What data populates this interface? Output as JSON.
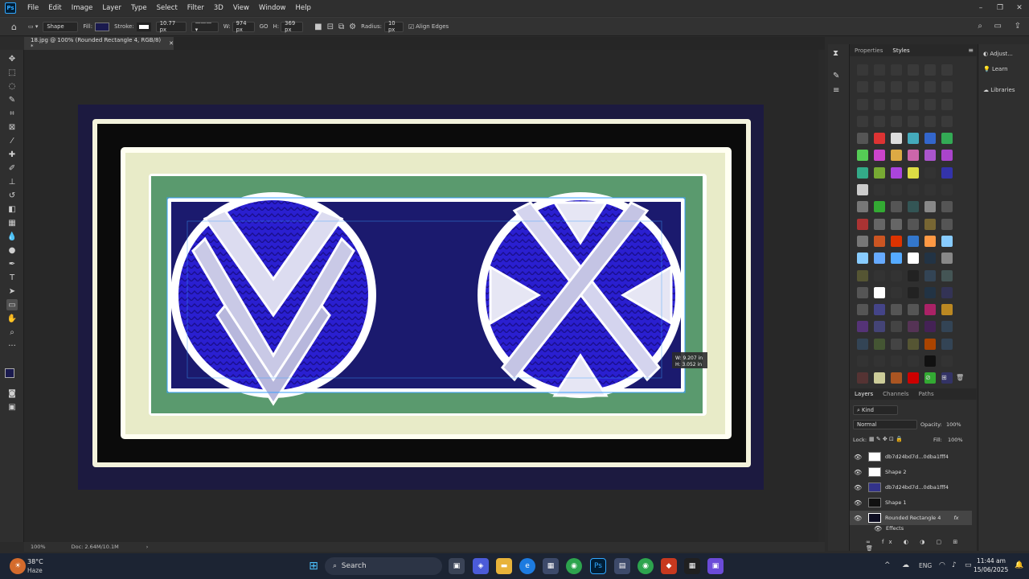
{
  "menu": [
    "File",
    "Edit",
    "Image",
    "Layer",
    "Type",
    "Select",
    "Filter",
    "3D",
    "View",
    "Window",
    "Help"
  ],
  "options": {
    "mode": "Shape",
    "fill_label": "Fill:",
    "stroke_label": "Stroke:",
    "stroke_width": "10.77 px",
    "w_label": "W:",
    "w_value": "974 px",
    "link": "GO",
    "h_label": "H:",
    "h_value": "369 px",
    "radius_label": "Radius:",
    "radius_value": "10 px",
    "align_edges": "Align Edges",
    "fill_color": "#1a1a4e",
    "stroke_color": "#ffffff"
  },
  "document": {
    "tab_title": "18.jpg @ 100% (Rounded Rectangle 4, RGB/8) *",
    "zoom": "100%",
    "doc_info": "Doc: 2.64M/10.1M",
    "transform_w": "W: 9.207 in",
    "transform_h": "H: 3.052 in"
  },
  "panels": {
    "top_tabs": [
      "Properties",
      "Styles"
    ],
    "right_items": [
      "Adjust...",
      "Learn",
      "Libraries"
    ],
    "layer_tabs": [
      "Layers",
      "Channels",
      "Paths"
    ],
    "kind": "Kind",
    "blend": "Normal",
    "opacity_label": "Opacity:",
    "opacity": "100%",
    "lock_label": "Lock:",
    "fill_label": "Fill:",
    "fill": "100%",
    "layers": [
      {
        "name": "db7d24bd7d...0dba1fff4"
      },
      {
        "name": "Shape 2"
      },
      {
        "name": "db7d24bd7d...0dba1fff4"
      },
      {
        "name": "Shape 1"
      },
      {
        "name": "Rounded Rectangle 4"
      },
      {
        "name": "Effects"
      }
    ],
    "fx": "fx"
  },
  "taskbar": {
    "temp": "38°C",
    "weather": "Haze",
    "search": "Search",
    "lang": "ENG",
    "time": "11:44 am",
    "date": "15/06/2025"
  }
}
